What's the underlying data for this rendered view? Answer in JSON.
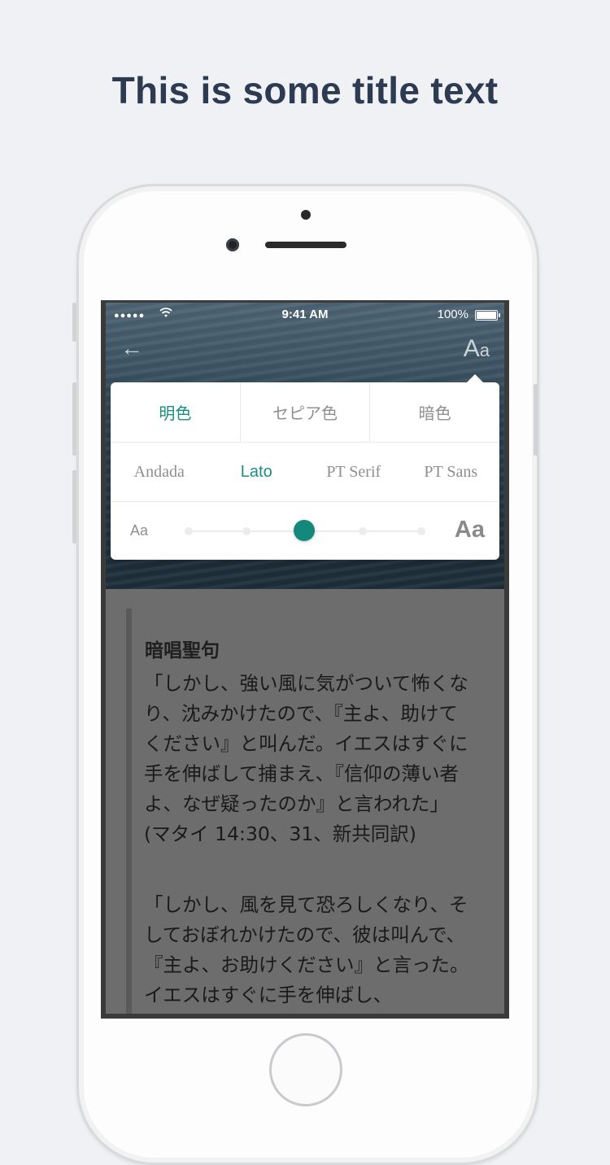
{
  "page": {
    "title": "This is some title text"
  },
  "status_bar": {
    "signal": "●●●●●",
    "time": "9:41 AM",
    "battery": "100%"
  },
  "toolbar": {
    "back_icon": "←",
    "font_settings_label": "A",
    "font_settings_small": "a"
  },
  "settings": {
    "themes": [
      {
        "label": "明色",
        "active": true
      },
      {
        "label": "セピア色",
        "active": false
      },
      {
        "label": "暗色",
        "active": false
      }
    ],
    "fonts": [
      {
        "label": "Andada",
        "active": false
      },
      {
        "label": "Lato",
        "active": true
      },
      {
        "label": "PT Serif",
        "active": false
      },
      {
        "label": "PT Sans",
        "active": false
      }
    ],
    "size": {
      "small_label": "Aa",
      "large_label": "Aa",
      "steps": 5,
      "selected_index": 2
    },
    "accent_color": "#1a8e82"
  },
  "reading": {
    "title": "暗唱聖句",
    "paragraphs": [
      "「しかし、強い風に気がついて怖くなり、沈みかけたので、『主よ、助けてください』と叫んだ。イエスはすぐに手を伸ばして捕まえ、『信仰の薄い者よ、なぜ疑ったのか』と言われた」 (マタイ 14:30、31、新共同訳)",
      "「しかし、風を見て恐ろしくなり、そしておぼれかけたので、彼は叫んで、『主よ、お助けください』と言った。イエスはすぐに手を伸ばし、"
    ]
  }
}
